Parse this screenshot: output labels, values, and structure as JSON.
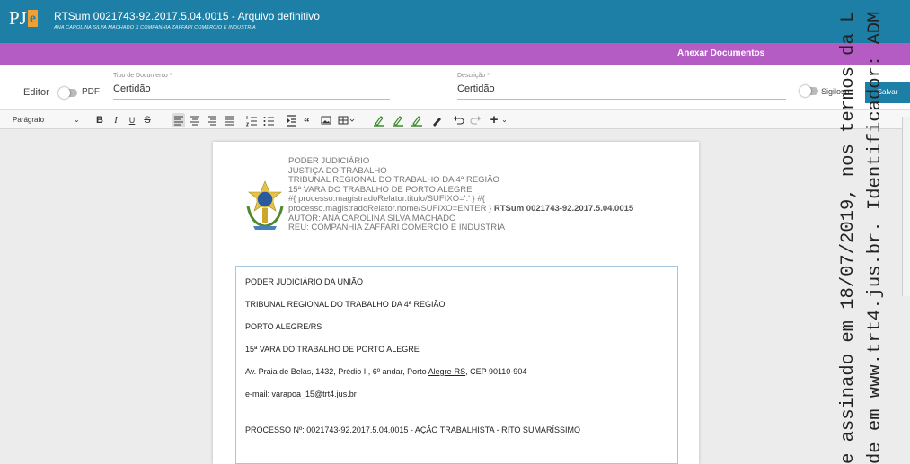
{
  "header": {
    "logo_text": "PJ",
    "logo_accent": "e",
    "title": "RTSum 0021743-92.2017.5.04.0015  - Arquivo definitivo",
    "subtitle": "ANA CAROLINA SILVA MACHADO X COMPANHIA ZAFFARI COMERCIO E INDUSTRIA"
  },
  "action_bar": {
    "label": "Anexar Documentos"
  },
  "form": {
    "editor_label": "Editor",
    "pdf_label": "PDF",
    "tipo_label": "Tipo de Documento *",
    "tipo_value": "Certidão",
    "descricao_label": "Descrição *",
    "descricao_value": "Certidão",
    "sigiloso_label": "Sigiloso",
    "salvar_label": "Salvar"
  },
  "toolbar": {
    "style_value": "Parágrafo",
    "chevron": "⌄",
    "bold": "B",
    "italic": "I",
    "underline": "U",
    "strike": "S",
    "insert": "+"
  },
  "document": {
    "header_lines": [
      "PODER JUDICIÁRIO",
      "JUSTIÇA DO TRABALHO",
      "TRIBUNAL REGIONAL DO TRABALHO DA 4ª REGIÃO",
      "15ª VARA DO TRABALHO DE PORTO ALEGRE",
      "#{ processo.magistradoRelator.titulo/SUFIXO=':' } #{",
      "processo.magistradoRelator.nome/SUFIXO=ENTER }",
      "AUTOR: ANA CAROLINA SILVA MACHADO",
      "RÉU: COMPANHIA ZAFFARI COMERCIO E INDUSTRIA"
    ],
    "header_process": "RTSum 0021743-92.2017.5.04.0015",
    "body": {
      "line1": "PODER JUDICIÁRIO DA UNIÃO",
      "line2": "TRIBUNAL REGIONAL DO TRABALHO DA 4ª REGIÃO",
      "line3": "PORTO ALEGRE/RS",
      "line4": "15ª VARA DO TRABALHO DE PORTO ALEGRE",
      "line5_pre": "Av. Praia de Belas, 1432, Prédio II, 6º andar, Porto ",
      "line5_link": "Alegre-RS",
      "line5_post": ", CEP 90110-904",
      "line6": "e-mail: varapoa_15@trt4.jus.br",
      "line7": "PROCESSO Nº: 0021743-92.2017.5.04.0015 - AÇÃO TRABALHISTA - RITO SUMARÍSSIMO"
    }
  },
  "watermark": {
    "line1": "e assinado em 18/07/2019, nos termos da L",
    "line2": "de em www.trt4.jus.br. Identificador: ADM"
  },
  "colors": {
    "primary": "#1e7fa6",
    "purple": "#b45bc4",
    "accent": "#f0a030",
    "marker": "#3a8a2a"
  }
}
